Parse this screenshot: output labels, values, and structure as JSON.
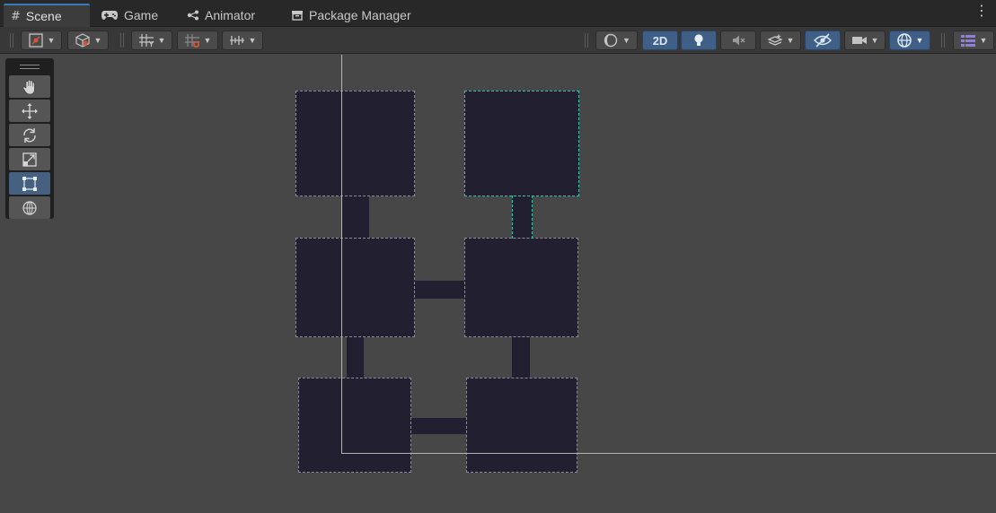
{
  "tabs": [
    {
      "label": "Scene",
      "icon": "grid-icon",
      "active": true
    },
    {
      "label": "Game",
      "icon": "gamepad-icon",
      "active": false
    },
    {
      "label": "Animator",
      "icon": "animator-icon",
      "active": false
    },
    {
      "label": "Package Manager",
      "icon": "package-icon",
      "active": false
    }
  ],
  "toolbar": {
    "toggle_2d_label": "2D"
  },
  "tool_palette": {
    "tools": [
      "hand-tool",
      "move-tool",
      "rotate-tool",
      "scale-tool",
      "rect-tool",
      "transform-tool"
    ],
    "active_tool": "rect-tool"
  },
  "scene": {
    "selected_room": "room-top-right",
    "accent_color": "#3dc4a4",
    "room_fill": "#221f31"
  }
}
